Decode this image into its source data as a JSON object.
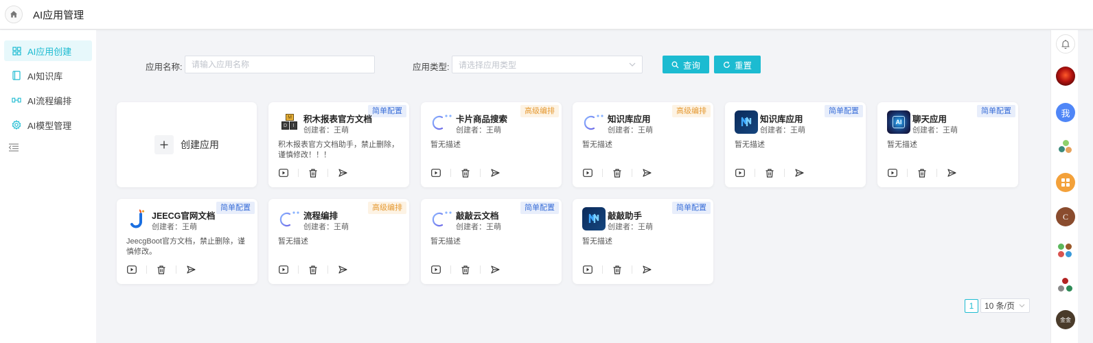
{
  "header": {
    "title": "AI应用管理"
  },
  "sidebar": {
    "items": [
      {
        "label": "AI应用创建",
        "icon": "grid-icon",
        "active": true
      },
      {
        "label": "AI知识库",
        "icon": "book-icon",
        "active": false
      },
      {
        "label": "AI流程编排",
        "icon": "flow-icon",
        "active": false
      },
      {
        "label": "AI模型管理",
        "icon": "gear-icon",
        "active": false
      }
    ]
  },
  "search": {
    "name_label": "应用名称:",
    "name_placeholder": "请输入应用名称",
    "type_label": "应用类型:",
    "type_placeholder": "请选择应用类型",
    "query_label": "查询",
    "reset_label": "重置"
  },
  "create_card": {
    "label": "创建应用"
  },
  "cards": [
    {
      "name": "积木报表官方文档",
      "creator": "创建者：王萌",
      "badge": "简单配置",
      "desc": "积木报表官方文档助手，禁止删除，谨慎修改！！！",
      "icon": "jimu-report-icon"
    },
    {
      "name": "卡片商品搜索",
      "creator": "创建者：王萌",
      "badge": "高级编排",
      "desc": "暂无描述",
      "icon": "ai-logo-icon"
    },
    {
      "name": "知识库应用",
      "creator": "创建者：王萌",
      "badge": "高级编排",
      "desc": "暂无描述",
      "icon": "ai-logo-icon"
    },
    {
      "name": "知识库应用",
      "creator": "创建者：王萌",
      "badge": "简单配置",
      "desc": "暂无描述",
      "icon": "blue-n-icon"
    },
    {
      "name": "聊天应用",
      "creator": "创建者：王萌",
      "badge": "简单配置",
      "desc": "暂无描述",
      "icon": "ai-chip-icon"
    },
    {
      "name": "JEECG官网文档",
      "creator": "创建者：王萌",
      "badge": "简单配置",
      "desc": "JeecgBoot官方文档，禁止删除，谨慎修改。",
      "icon": "jeecg-logo-icon"
    },
    {
      "name": "流程编排",
      "creator": "创建者：王萌",
      "badge": "高级编排",
      "desc": "暂无描述",
      "icon": "ai-logo-icon"
    },
    {
      "name": "敲敲云文档",
      "creator": "创建者：王萌",
      "badge": "简单配置",
      "desc": "暂无描述",
      "icon": "ai-logo-icon"
    },
    {
      "name": "敲敲助手",
      "creator": "创建者：王萌",
      "badge": "简单配置",
      "desc": "暂无描述",
      "icon": "blue-n-icon"
    }
  ],
  "pagination": {
    "current": "1",
    "page_size": "10 条/页"
  },
  "rail": {
    "me_label": "我",
    "c_label": "C",
    "gold_label": "金金",
    "badge_simple_color": "#3a6fd8",
    "badge_advanced_color": "#e59a34",
    "accent": "#1cbbd1"
  }
}
